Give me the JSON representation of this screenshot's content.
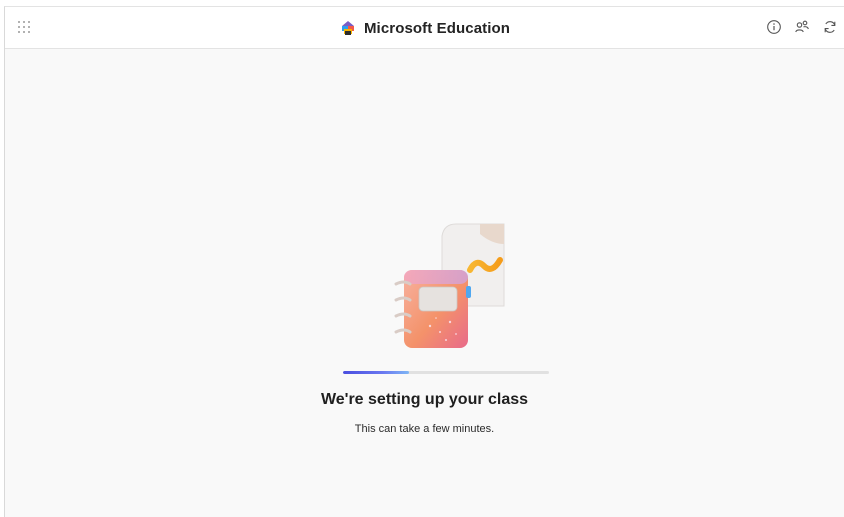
{
  "header": {
    "app_title": "Microsoft Education",
    "waffle_icon": "app-launcher-icon",
    "actions": [
      {
        "name": "info-icon"
      },
      {
        "name": "people-icon"
      },
      {
        "name": "refresh-icon"
      }
    ]
  },
  "main": {
    "progress_fraction": 0.32,
    "status_title": "We're setting up your class",
    "status_subtitle": "This can take a few minutes."
  },
  "colors": {
    "progress_start": "#4a4ee0",
    "progress_end": "#7fb6f5",
    "notebook": "#f4926a",
    "page_background": "#f9f9f9"
  }
}
